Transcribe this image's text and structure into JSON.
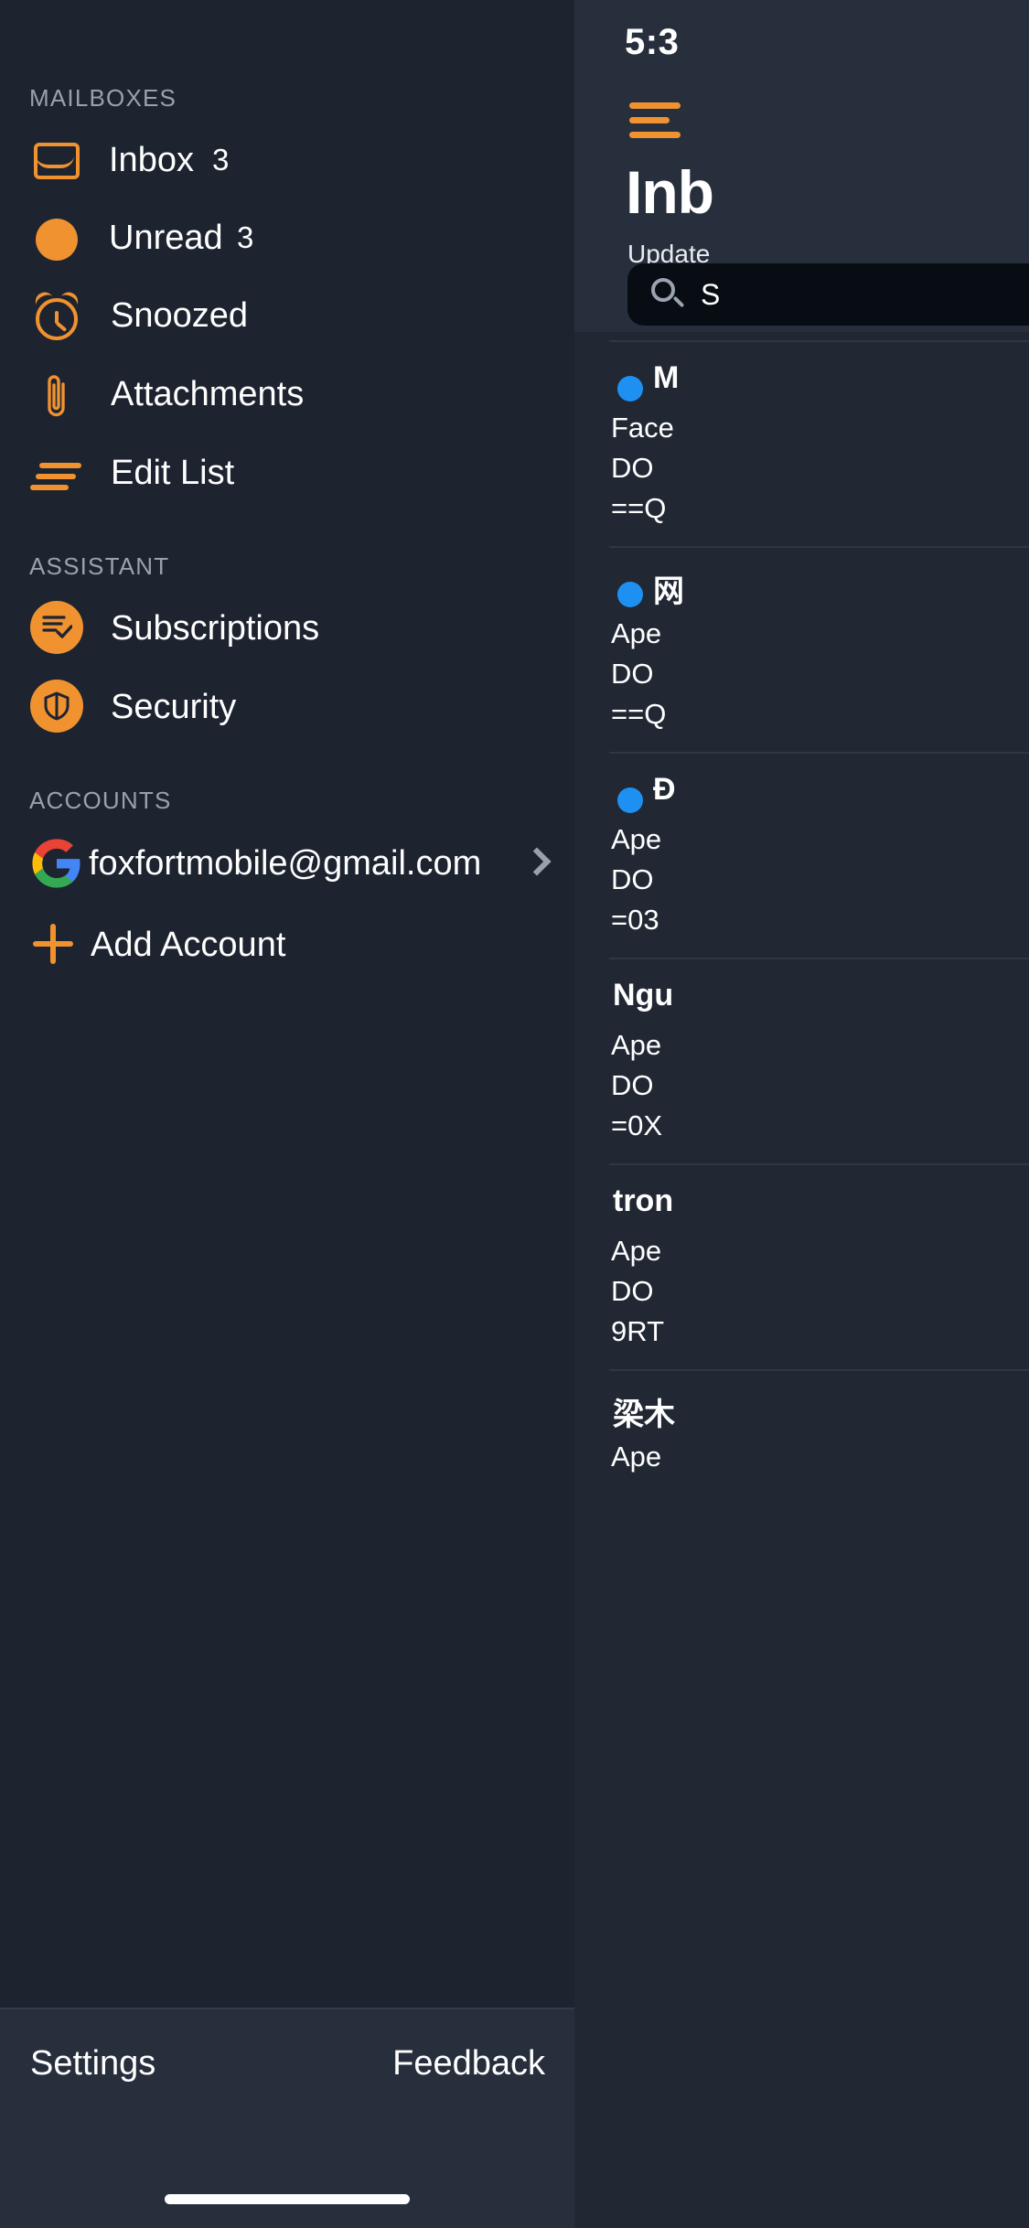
{
  "status_bar": {
    "time": "5:3"
  },
  "inbox_panel": {
    "hamburger_icon": "hamburger-menu-icon",
    "title": "Inb",
    "subtitle": "Update",
    "search": {
      "icon": "search-icon",
      "label": "S",
      "placeholder": "Search"
    },
    "messages": [
      {
        "unread": true,
        "sender": "M",
        "line2": "Face",
        "line3": "DO",
        "line4": "==Q"
      },
      {
        "unread": true,
        "sender": "网",
        "line2": "Ape",
        "line3": "DO",
        "line4": "==Q"
      },
      {
        "unread": true,
        "sender": "Ð",
        "line2": "Ape",
        "line3": "DO",
        "line4": "=03"
      },
      {
        "unread": false,
        "sender": "Ngu",
        "line2": "Ape",
        "line3": "DO",
        "line4": "=0X"
      },
      {
        "unread": false,
        "sender": "tron",
        "line2": "Ape",
        "line3": "DO",
        "line4": "9RT"
      },
      {
        "unread": false,
        "sender": "梁木",
        "line2": "Ape",
        "line3": "",
        "line4": ""
      }
    ]
  },
  "sidebar": {
    "sections": [
      {
        "title": "MAILBOXES",
        "items": [
          {
            "icon": "inbox-icon",
            "label": "Inbox",
            "badge": "3"
          },
          {
            "icon": "unread-dot-icon",
            "label": "Unread",
            "badge": "3"
          },
          {
            "icon": "alarm-clock-icon",
            "label": "Snoozed",
            "badge": ""
          },
          {
            "icon": "paperclip-icon",
            "label": "Attachments",
            "badge": ""
          },
          {
            "icon": "edit-list-icon",
            "label": "Edit List",
            "badge": ""
          }
        ]
      },
      {
        "title": "ASSISTANT",
        "items": [
          {
            "icon": "subscriptions-icon",
            "label": "Subscriptions",
            "badge": ""
          },
          {
            "icon": "shield-icon",
            "label": "Security",
            "badge": ""
          }
        ]
      },
      {
        "title": "ACCOUNTS",
        "items": [
          {
            "icon": "google-icon",
            "label": "foxfortmobile@gmail.com",
            "badge": ""
          },
          {
            "icon": "plus-icon",
            "label": "Add Account",
            "badge": ""
          }
        ]
      }
    ],
    "footer": {
      "settings_label": "Settings",
      "feedback_label": "Feedback"
    }
  },
  "colors": {
    "accent_orange": "#f0922f",
    "unread_blue": "#1e90f2",
    "sidebar_bg": "#1d2430",
    "panel_bg": "#212834",
    "footer_bg": "#272f3d"
  }
}
